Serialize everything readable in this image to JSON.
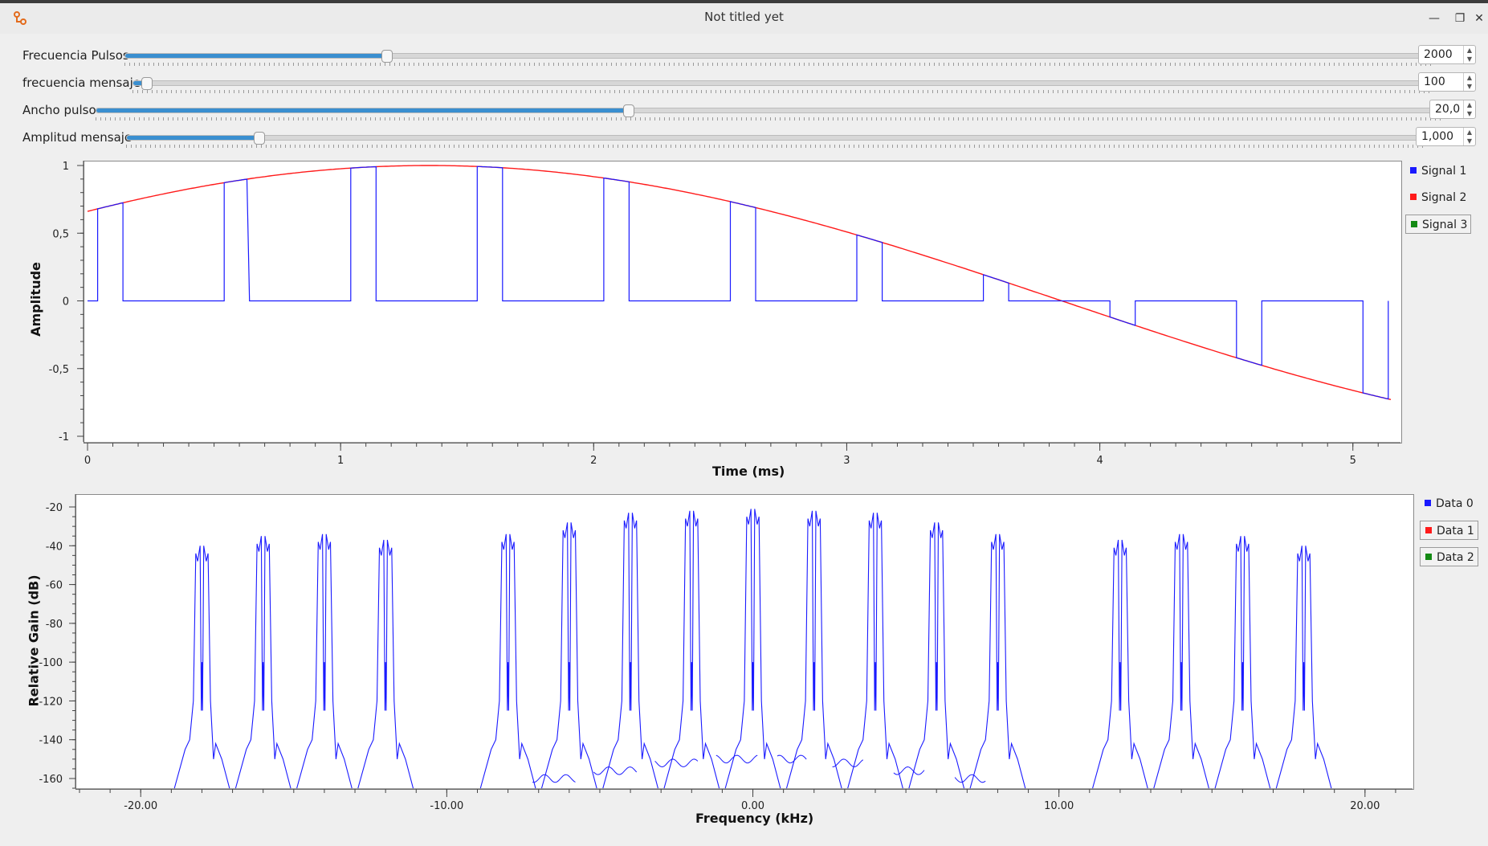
{
  "window": {
    "title": "Not titled yet",
    "buttons": {
      "minimize": "—",
      "maximize": "❐",
      "close": "✕"
    }
  },
  "controls": [
    {
      "label": "Frecuencia Pulsos",
      "value": "2000",
      "fraction": 0.2
    },
    {
      "label": "frecuencia mensaje",
      "value": "100",
      "fraction": 0.01
    },
    {
      "label": "Ancho pulso",
      "value": "20,0",
      "fraction": 0.4
    },
    {
      "label": "Amplitud mensaje",
      "value": "1,000",
      "fraction": 0.1
    }
  ],
  "time_plot": {
    "xlabel": "Time (ms)",
    "ylabel": "Amplitude",
    "xticks": [
      "0",
      "1",
      "2",
      "3",
      "4",
      "5"
    ],
    "yticks": [
      "1",
      "0,5",
      "0",
      "-0,5",
      "-1"
    ],
    "legend": [
      {
        "name": "Signal 1",
        "color": "#1a1aff"
      },
      {
        "name": "Signal 2",
        "color": "#ff1a1a"
      },
      {
        "name": "Signal 3",
        "color": "#148a14"
      }
    ]
  },
  "freq_plot": {
    "xlabel": "Frequency (kHz)",
    "ylabel": "Relative Gain (dB)",
    "xticks": [
      "-20.00",
      "-10.00",
      "0.00",
      "10.00",
      "20.00"
    ],
    "yticks": [
      "-20",
      "-40",
      "-60",
      "-80",
      "-100",
      "-120",
      "-140",
      "-160"
    ],
    "legend": [
      {
        "name": "Data 0",
        "color": "#1a1aff"
      },
      {
        "name": "Data 1",
        "color": "#ff1a1a"
      },
      {
        "name": "Data 2",
        "color": "#148a14"
      }
    ]
  },
  "chart_data": [
    {
      "type": "line",
      "xlabel": "Time (ms)",
      "ylabel": "Amplitude",
      "xlim": [
        0,
        5.15
      ],
      "ylim": [
        -1,
        1
      ],
      "grid": false,
      "legend_position": "right",
      "series": [
        {
          "name": "Signal 1",
          "color": "#1a1aff",
          "description_type": "PAM pulses sampling Signal 2",
          "pulse_starts_ms": [
            0.04,
            0.54,
            1.04,
            1.54,
            2.04,
            2.54,
            3.04,
            3.54,
            4.04,
            4.54,
            5.04
          ],
          "pulse_width_ms": 0.1
        },
        {
          "name": "Signal 2",
          "color": "#ff1a1a",
          "x": [
            0,
            0.5,
            1.0,
            1.3,
            1.5,
            2.0,
            2.5,
            3.0,
            3.5,
            3.85,
            4.0,
            4.5,
            5.0,
            5.15
          ],
          "y": [
            0.67,
            0.88,
            0.98,
            1.0,
            0.99,
            0.9,
            0.72,
            0.48,
            0.2,
            0.0,
            -0.1,
            -0.39,
            -0.66,
            -0.71
          ]
        },
        {
          "name": "Signal 3",
          "color": "#148a14",
          "x": [],
          "y": []
        }
      ]
    },
    {
      "type": "line",
      "xlabel": "Frequency (kHz)",
      "ylabel": "Relative Gain (dB)",
      "xlim": [
        -22,
        21.5
      ],
      "ylim": [
        -165,
        -15
      ],
      "grid": false,
      "legend_position": "right",
      "series": [
        {
          "name": "Data 0",
          "color": "#1a1aff",
          "peak_centers_khz": [
            -18,
            -16,
            -14,
            -12,
            -8,
            -6,
            -4,
            -2,
            0,
            2,
            4,
            6,
            8,
            12,
            14,
            16,
            18
          ],
          "peak_levels_db": [
            -48,
            -43,
            -42,
            -45,
            -42,
            -36,
            -31,
            -30,
            -29,
            -30,
            -31,
            -36,
            -42,
            -45,
            -42,
            -43,
            -48
          ],
          "floor_db": -165
        },
        {
          "name": "Data 1",
          "color": "#ff1a1a",
          "x": [],
          "y": []
        },
        {
          "name": "Data 2",
          "color": "#148a14",
          "x": [],
          "y": []
        }
      ]
    }
  ]
}
